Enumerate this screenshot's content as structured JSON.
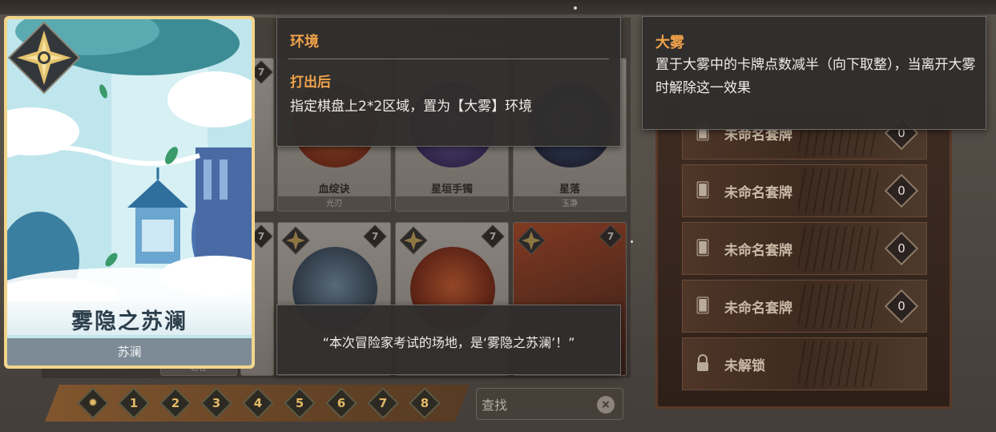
{
  "featured_card": {
    "title": "雾隐之苏澜",
    "subtitle": "苏澜",
    "emblem_icon": "sun-star-emblem"
  },
  "background_cards": [
    {
      "name": "血绽诀",
      "sub": "光刃"
    },
    {
      "name": "星垣手镯",
      "sub": ""
    },
    {
      "name": "星落",
      "sub": "玉瀞"
    },
    {
      "name": "",
      "sub": "",
      "cost": "7"
    },
    {
      "name": "",
      "sub": "",
      "cost": "7"
    },
    {
      "name": "",
      "sub": "",
      "cost": "7"
    }
  ],
  "background_misc": {
    "top_card_cost": "7",
    "left_card_cost": "7",
    "bottom_left_label": "若言"
  },
  "tooltip_environment": {
    "title": "环境",
    "trigger": "打出后",
    "description": "指定棋盘上2*2区域，置为【大雾】环境"
  },
  "tooltip_fog": {
    "title": "大雾",
    "description": "置于大雾中的卡牌点数减半（向下取整），当离开大雾时解除这一效果"
  },
  "tooltip_quote": {
    "text": "“本次冒险家考试的场地，是‘雾隐之苏澜’！”"
  },
  "filter_bar": {
    "cost_filters": [
      "1",
      "2",
      "3",
      "4",
      "5",
      "6",
      "7",
      "8"
    ],
    "search_placeholder": "查找",
    "clear_icon": "×"
  },
  "deck_panel": {
    "decks": [
      {
        "label": "未命名套牌",
        "count": "0"
      },
      {
        "label": "未命名套牌",
        "count": "0"
      },
      {
        "label": "未命名套牌",
        "count": "0"
      },
      {
        "label": "未命名套牌",
        "count": "0"
      }
    ],
    "locked": {
      "label": "未解锁"
    }
  },
  "colors": {
    "accent_orange": "#f0a24a",
    "card_frame_gold": "#f2d58c",
    "tooltip_bg": "#302e2d"
  }
}
